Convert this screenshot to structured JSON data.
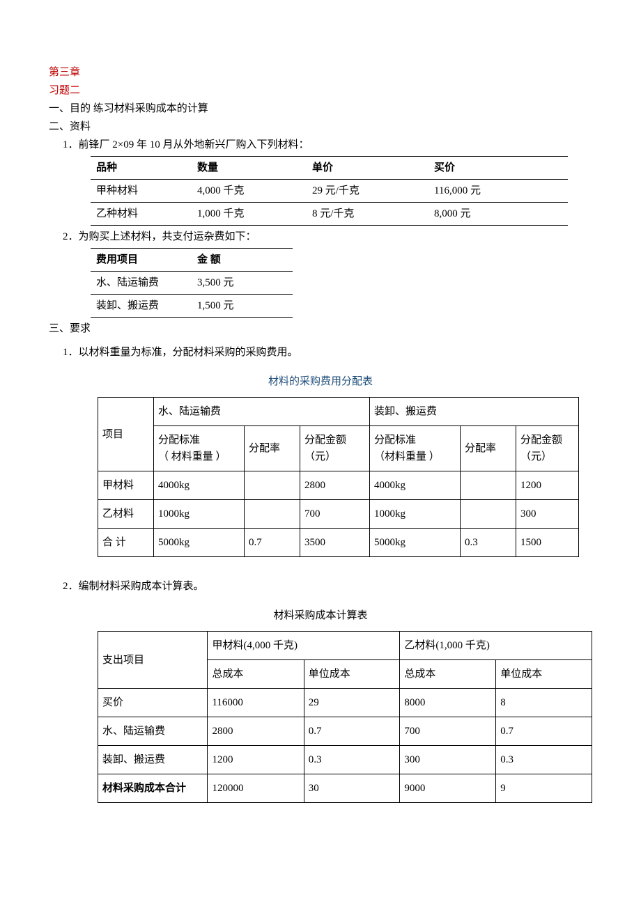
{
  "headings": {
    "chapter": "第三章",
    "exercise": "习题二",
    "line1": "一、目的   练习材料采购成本的计算",
    "line2": "二、资料",
    "info1": "1．前锋厂 2×09 年 10 月从外地新兴厂购入下列材料：",
    "info2": "2．为购买上述材料，共支付运杂费如下：",
    "line3": "三、要求",
    "req1": "1．以材料重量为标准，分配材料采购的采购费用。",
    "allocTitle": "材料的采购费用分配表",
    "req2": "2．编制材料采购成本计算表。",
    "costTitle": "材料采购成本计算表"
  },
  "materialsTable": {
    "headers": [
      "品种",
      "数量",
      "单价",
      "买价"
    ],
    "rows": [
      [
        "甲种材料",
        "4,000 千克",
        "29 元/千克",
        "116,000 元"
      ],
      [
        "乙种材料",
        "1,000 千克",
        "8 元/千克",
        "8,000 元"
      ]
    ]
  },
  "feesTable": {
    "headers": [
      "费用项目",
      "金   额"
    ],
    "rows": [
      [
        "水、陆运输费",
        "3,500 元"
      ],
      [
        "装卸、搬运费",
        "1,500 元"
      ]
    ]
  },
  "allocTable": {
    "header": {
      "item": "项目",
      "group1": "水、陆运输费",
      "group2": "装卸、搬运费",
      "std": "分配标准",
      "stdSub": "（ 材料重量 ）",
      "stdSub2": "（材料重量 ）",
      "rate": "分配率",
      "amount": "分配金额",
      "amountSub": "（元）"
    },
    "rows": [
      {
        "name": "甲材料",
        "std1": "4000kg",
        "rate1": "",
        "amt1": "2800",
        "std2": "4000kg",
        "rate2": "",
        "amt2": "1200"
      },
      {
        "name": "乙材料",
        "std1": "1000kg",
        "rate1": "",
        "amt1": "700",
        "std2": "1000kg",
        "rate2": "",
        "amt2": "300"
      },
      {
        "name": "合   计",
        "std1": "5000kg",
        "rate1": "0.7",
        "amt1": "3500",
        "std2": "5000kg",
        "rate2": "0.3",
        "amt2": "1500"
      }
    ]
  },
  "costTable": {
    "header": {
      "expense": "支出项目",
      "mat1": "甲材料(4,000 千克)",
      "mat2": "乙材料(1,000 千克)",
      "total": "总成本",
      "unit": "单位成本"
    },
    "rows": [
      {
        "name": "买价",
        "t1": "116000",
        "u1": "29",
        "t2": "8000",
        "u2": "8"
      },
      {
        "name": "水、陆运输费",
        "t1": "2800",
        "u1": "0.7",
        "t2": "700",
        "u2": "0.7"
      },
      {
        "name": "装卸、搬运费",
        "t1": "1200",
        "u1": "0.3",
        "t2": "300",
        "u2": "0.3"
      },
      {
        "name": "材料采购成本合计",
        "t1": "120000",
        "u1": "30",
        "t2": "9000",
        "u2": "9",
        "bold": true
      }
    ]
  }
}
